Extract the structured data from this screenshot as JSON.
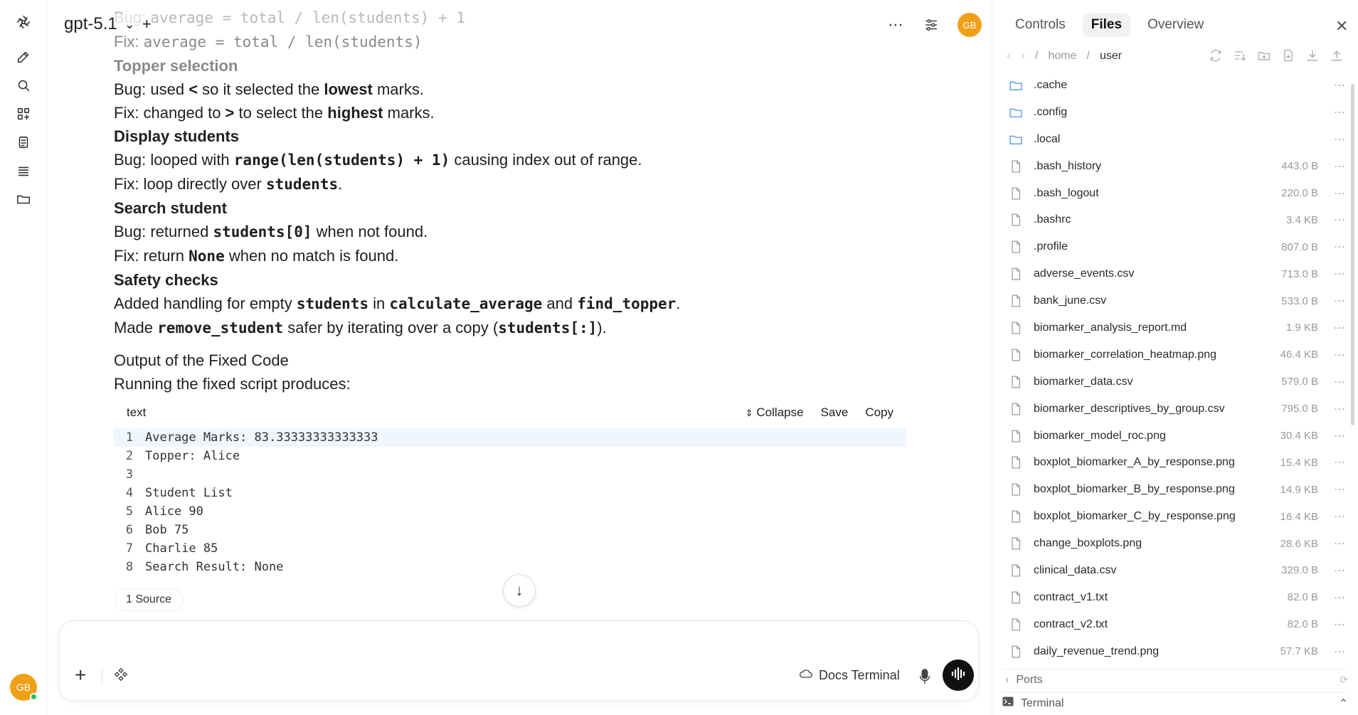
{
  "app": {
    "model_name": "gpt-5.1",
    "avatar_initials": "GB",
    "new_chat_symbol": "+"
  },
  "rail": {
    "icons": [
      "logo-icon",
      "new-chat-icon",
      "search-icon",
      "apps-icon",
      "notes-icon",
      "list-icon",
      "folder-icon"
    ]
  },
  "message": {
    "faded_line1_label": "Bug: ",
    "faded_line1_code": "average = total / len(students) + 1",
    "faded_line2_label": "Fix: ",
    "faded_line2_code": "average = total / len(students)",
    "topper_heading": "Topper selection",
    "topper_bug_a": "Bug: used ",
    "topper_bug_sym": "<",
    "topper_bug_b": " so it selected the ",
    "topper_bug_bold": "lowest",
    "topper_bug_c": " marks.",
    "topper_fix_a": "Fix: changed to ",
    "topper_fix_sym": ">",
    "topper_fix_b": " to select the ",
    "topper_fix_bold": "highest",
    "topper_fix_c": " marks.",
    "display_heading": "Display students",
    "display_bug_a": "Bug: looped with ",
    "display_bug_code": "range(len(students) + 1)",
    "display_bug_b": " causing index out of range.",
    "display_fix_a": "Fix: loop directly over ",
    "display_fix_code": "students",
    "display_fix_b": ".",
    "search_heading": "Search student",
    "search_bug_a": "Bug: returned ",
    "search_bug_code": "students[0]",
    "search_bug_b": " when not found.",
    "search_fix_a": "Fix: return ",
    "search_fix_code": "None",
    "search_fix_b": " when no match is found.",
    "safety_heading": "Safety checks",
    "safety_1_a": "Added handling for empty ",
    "safety_1_code1": "students",
    "safety_1_b": " in ",
    "safety_1_code2": "calculate_average",
    "safety_1_c": " and ",
    "safety_1_code3": "find_topper",
    "safety_1_d": ".",
    "safety_2_a": "Made ",
    "safety_2_code1": "remove_student",
    "safety_2_b": " safer by iterating over a copy (",
    "safety_2_code2": "students[:]",
    "safety_2_c": ").",
    "output_heading": "Output of the Fixed Code",
    "output_intro": "Running the fixed script produces:"
  },
  "codeblock": {
    "language": "text",
    "collapse_label": "Collapse",
    "save_label": "Save",
    "copy_label": "Copy",
    "lines": [
      {
        "n": "1",
        "text": "Average Marks: 83.33333333333333"
      },
      {
        "n": "2",
        "text": "Topper: Alice"
      },
      {
        "n": "3",
        "text": ""
      },
      {
        "n": "4",
        "text": "Student List"
      },
      {
        "n": "5",
        "text": "Alice 90"
      },
      {
        "n": "6",
        "text": "Bob 75"
      },
      {
        "n": "7",
        "text": "Charlie 85"
      },
      {
        "n": "8",
        "text": "Search Result: None"
      }
    ]
  },
  "sources_label": "1 Source",
  "composer": {
    "placeholder": "",
    "docs_terminal_label": "Docs Terminal"
  },
  "panel": {
    "tabs": [
      "Controls",
      "Files",
      "Overview"
    ],
    "active_tab": "Files",
    "crumbs": [
      "home",
      "user"
    ],
    "files": [
      {
        "name": ".cache",
        "size": "",
        "type": "folder"
      },
      {
        "name": ".config",
        "size": "",
        "type": "folder"
      },
      {
        "name": ".local",
        "size": "",
        "type": "folder"
      },
      {
        "name": ".bash_history",
        "size": "443.0 B",
        "type": "file"
      },
      {
        "name": ".bash_logout",
        "size": "220.0 B",
        "type": "file"
      },
      {
        "name": ".bashrc",
        "size": "3.4 KB",
        "type": "file"
      },
      {
        "name": ".profile",
        "size": "807.0 B",
        "type": "file"
      },
      {
        "name": "adverse_events.csv",
        "size": "713.0 B",
        "type": "file"
      },
      {
        "name": "bank_june.csv",
        "size": "533.0 B",
        "type": "file"
      },
      {
        "name": "biomarker_analysis_report.md",
        "size": "1.9 KB",
        "type": "file"
      },
      {
        "name": "biomarker_correlation_heatmap.png",
        "size": "46.4 KB",
        "type": "file"
      },
      {
        "name": "biomarker_data.csv",
        "size": "579.0 B",
        "type": "file"
      },
      {
        "name": "biomarker_descriptives_by_group.csv",
        "size": "795.0 B",
        "type": "file"
      },
      {
        "name": "biomarker_model_roc.png",
        "size": "30.4 KB",
        "type": "file"
      },
      {
        "name": "boxplot_biomarker_A_by_response.png",
        "size": "15.4 KB",
        "type": "file"
      },
      {
        "name": "boxplot_biomarker_B_by_response.png",
        "size": "14.9 KB",
        "type": "file"
      },
      {
        "name": "boxplot_biomarker_C_by_response.png",
        "size": "16.4 KB",
        "type": "file"
      },
      {
        "name": "change_boxplots.png",
        "size": "28.6 KB",
        "type": "file"
      },
      {
        "name": "clinical_data.csv",
        "size": "329.0 B",
        "type": "file"
      },
      {
        "name": "contract_v1.txt",
        "size": "82.0 B",
        "type": "file"
      },
      {
        "name": "contract_v2.txt",
        "size": "82.0 B",
        "type": "file"
      },
      {
        "name": "daily_revenue_trend.png",
        "size": "57.7 KB",
        "type": "file"
      }
    ],
    "ports_label": "Ports",
    "terminal_label": "Terminal"
  },
  "colors": {
    "accent_avatar": "#f0a018",
    "folder_blue": "#4a90e2",
    "online_green": "#24c060"
  }
}
